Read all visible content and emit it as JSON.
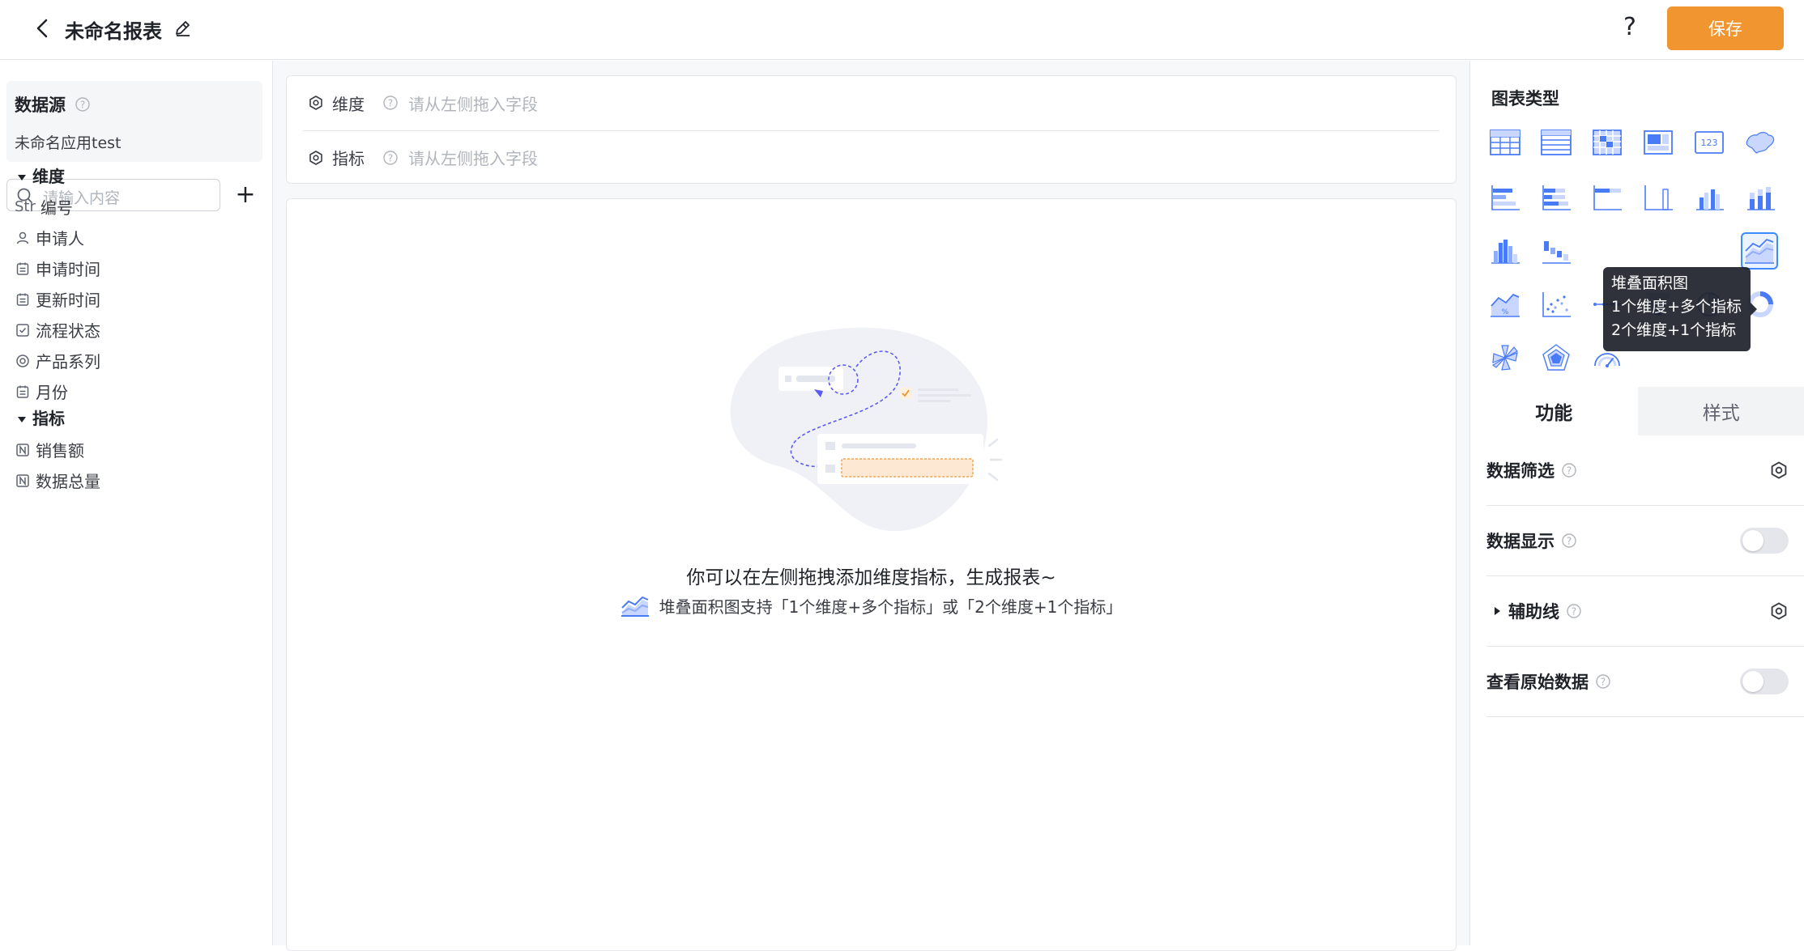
{
  "header": {
    "title": "未命名报表",
    "help_glyph": "?",
    "save_label": "保存"
  },
  "sidebar": {
    "datasource_title": "数据源",
    "datasource_name": "未命名应用test",
    "search_placeholder": "请输入内容",
    "add_glyph": "+",
    "dimension_group": "维度",
    "measure_group": "指标",
    "dimensions": [
      {
        "label": "编号",
        "type_tag": "Str",
        "icon": "string-icon"
      },
      {
        "label": "申请人",
        "icon": "user-icon"
      },
      {
        "label": "申请时间",
        "icon": "calendar-icon"
      },
      {
        "label": "更新时间",
        "icon": "calendar-icon"
      },
      {
        "label": "流程状态",
        "icon": "checkbox-icon"
      },
      {
        "label": "产品系列",
        "icon": "radio-icon"
      },
      {
        "label": "月份",
        "icon": "calendar-icon"
      }
    ],
    "measures": [
      {
        "label": "销售额",
        "icon": "number-icon"
      },
      {
        "label": "数据总量",
        "icon": "number-icon"
      }
    ]
  },
  "builder": {
    "dimension_label": "维度",
    "measure_label": "指标",
    "drop_placeholder": "请从左侧拖入字段"
  },
  "empty_state": {
    "message": "你可以在左侧拖拽添加维度指标，生成报表~",
    "hint": "堆叠面积图支持「1个维度+多个指标」或「2个维度+1个指标」"
  },
  "panel": {
    "chart_type_title": "图表类型",
    "tooltip": {
      "title": "堆叠面积图",
      "line1": "1个维度+多个指标",
      "line2": "2个维度+1个指标"
    },
    "tab_function": "功能",
    "tab_style": "样式",
    "options": [
      {
        "label": "数据筛选",
        "control": "settings"
      },
      {
        "label": "数据显示",
        "control": "toggle",
        "on": false
      },
      {
        "label": "辅助线",
        "control": "settings",
        "collapsible": true
      },
      {
        "label": "查看原始数据",
        "control": "toggle",
        "on": false
      }
    ]
  },
  "colors": {
    "accent": "#f0952f",
    "chart_icon": "#4a7bf7",
    "selected_border": "#3d8bff"
  }
}
